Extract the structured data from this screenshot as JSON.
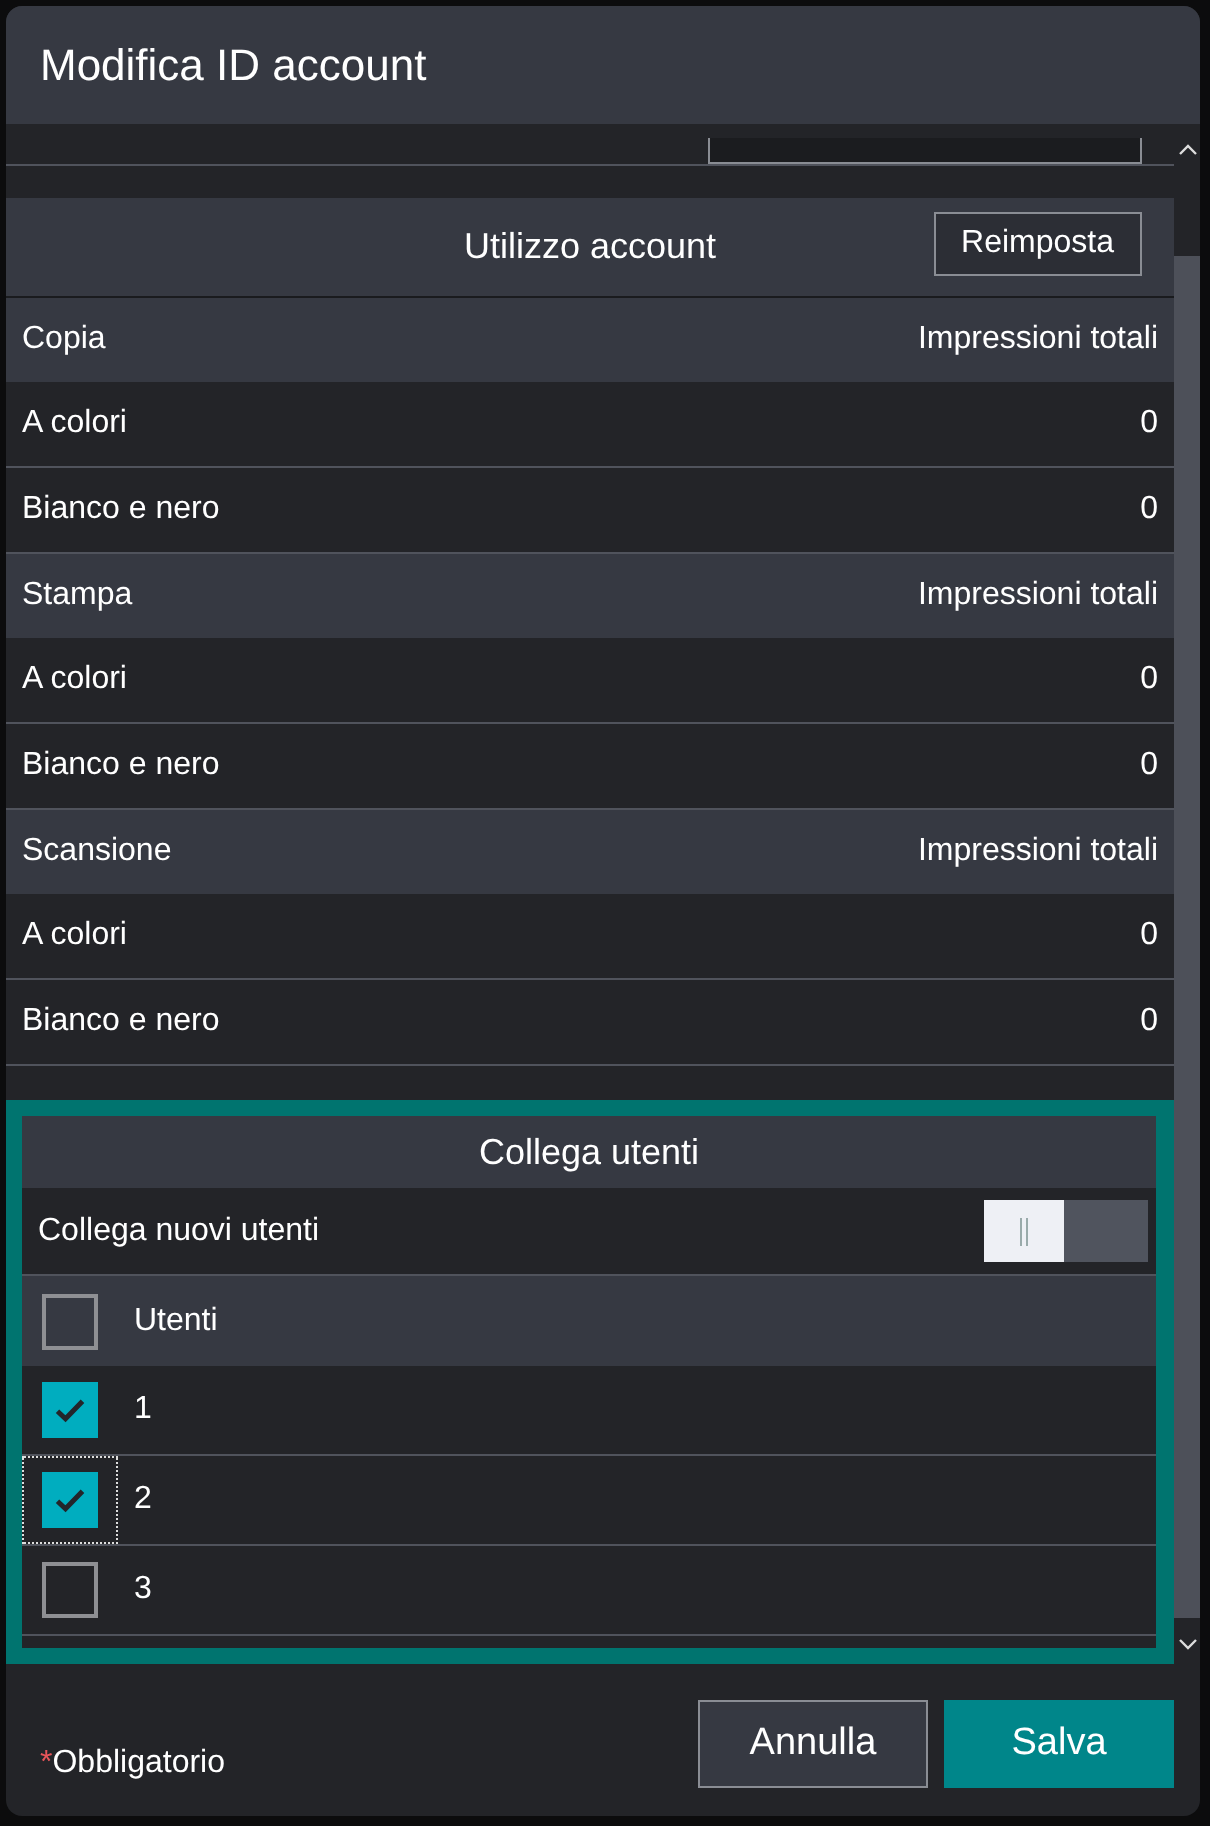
{
  "dialog": {
    "title": "Modifica ID account"
  },
  "usage": {
    "title": "Utilizzo account",
    "reset_button": "Reimposta",
    "sections": [
      {
        "name": "Copia",
        "column": "Impressioni totali",
        "rows": [
          {
            "label": "A colori",
            "value": "0"
          },
          {
            "label": "Bianco e nero",
            "value": "0"
          }
        ]
      },
      {
        "name": "Stampa",
        "column": "Impressioni totali",
        "rows": [
          {
            "label": "A colori",
            "value": "0"
          },
          {
            "label": "Bianco e nero",
            "value": "0"
          }
        ]
      },
      {
        "name": "Scansione",
        "column": "Impressioni totali",
        "rows": [
          {
            "label": "A colori",
            "value": "0"
          },
          {
            "label": "Bianco e nero",
            "value": "0"
          }
        ]
      }
    ]
  },
  "link_users": {
    "title": "Collega utenti",
    "toggle_label": "Collega nuovi utenti",
    "toggle_on": false,
    "header": {
      "label": "Utenti",
      "checked": false
    },
    "rows": [
      {
        "label": "1",
        "checked": true,
        "focused": false
      },
      {
        "label": "2",
        "checked": true,
        "focused": true
      },
      {
        "label": "3",
        "checked": false,
        "focused": false
      }
    ]
  },
  "footer": {
    "required_mark": "*",
    "required_text": "Obbligatorio",
    "buttons": [
      {
        "label": "Annulla",
        "kind": "secondary"
      },
      {
        "label": "Salva",
        "kind": "primary"
      }
    ]
  }
}
